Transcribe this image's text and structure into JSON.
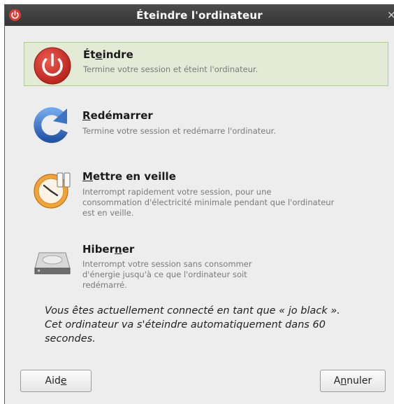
{
  "window": {
    "title": "Éteindre l'ordinateur",
    "close_glyph": "×"
  },
  "options": [
    {
      "label_pre": "Ét",
      "label_mn": "e",
      "label_post": "indre",
      "description": "Termine votre session et éteint l'ordinateur.",
      "icon": "power-icon",
      "selected": true
    },
    {
      "label_pre": "",
      "label_mn": "R",
      "label_post": "edémarrer",
      "description": "Termine votre session et redémarre l'ordinateur.",
      "icon": "restart-icon",
      "selected": false
    },
    {
      "label_pre": "",
      "label_mn": "M",
      "label_post": "ettre en veille",
      "description_lines": [
        "Interrompt rapidement votre session, pour  une",
        "consommation d'électricité minimale pendant que l'ordinateur",
        "est en veille."
      ],
      "icon": "suspend-clock-icon",
      "selected": false
    },
    {
      "label_pre": "Hiber",
      "label_mn": "n",
      "label_post": "er",
      "description_lines": [
        "Interrompt votre session sans consommer",
        "d'énergie jusqu'à ce que l'ordinateur soit",
        "redémarré."
      ],
      "icon": "hard-disk-icon",
      "selected": false
    }
  ],
  "message": [
    "Vous êtes actuellement connecté en tant que « jo black ».",
    "Cet ordinateur va s'éteindre automatiquement dans 60",
    "secondes."
  ],
  "buttons": {
    "help": {
      "pre": "Aid",
      "mn": "e",
      "post": ""
    },
    "cancel": {
      "pre": "A",
      "mn": "n",
      "post": "nuler"
    }
  },
  "colors": {
    "titlebar": "#3f3f3f",
    "selected_bg": "#e3ebd6",
    "power_red": "#d6322c",
    "restart_blue": "#3b75c4",
    "suspend_orange": "#f0a030"
  }
}
